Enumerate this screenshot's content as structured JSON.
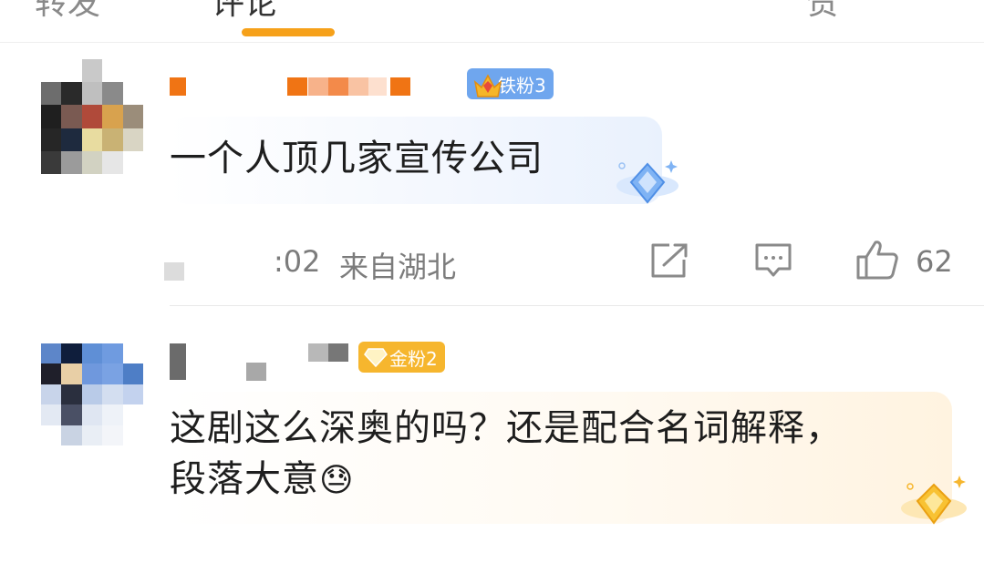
{
  "tabs": [
    {
      "label": "转发"
    },
    {
      "label": "评论"
    },
    {
      "label": "赞"
    }
  ],
  "comments": [
    {
      "fan_badge": "铁粉3",
      "text": "一个人顶几家宣传公司",
      "time": ":02",
      "location": "来自湖北",
      "likes": "62"
    },
    {
      "fan_badge": "金粉2",
      "text_line1": "这剧这么深奥的吗？还是配合名词解释，",
      "text_line2": "段落大意",
      "emoji": "😓"
    }
  ],
  "icons": {
    "share": "share-icon",
    "comment": "comment-icon",
    "like": "thumbs-up-icon"
  },
  "colors": {
    "accent": "#f6a11a",
    "iron_badge": "#6fa6ee",
    "gold_badge": "#f6b62e"
  }
}
